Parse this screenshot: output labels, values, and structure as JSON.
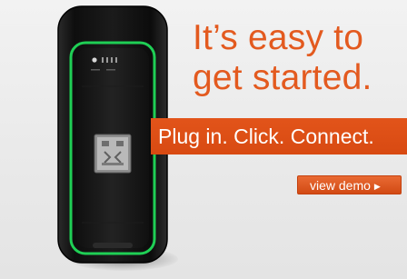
{
  "promo": {
    "headline_line1": "It’s easy to",
    "headline_line2": "get started.",
    "tagline": "Plug in. Click. Connect.",
    "demo_button_label": "view demo",
    "demo_button_arrow": "▶"
  },
  "colors": {
    "accent": "#e35a1f",
    "banner": "#dc4f16",
    "device_trim": "#22c55e",
    "device_body": "#141414"
  },
  "icons": {
    "device_image": "usb-modem-image",
    "status_lights": "status-lights-icon",
    "usb_connector": "usb-connector-icon",
    "arrow": "play-arrow-icon"
  }
}
